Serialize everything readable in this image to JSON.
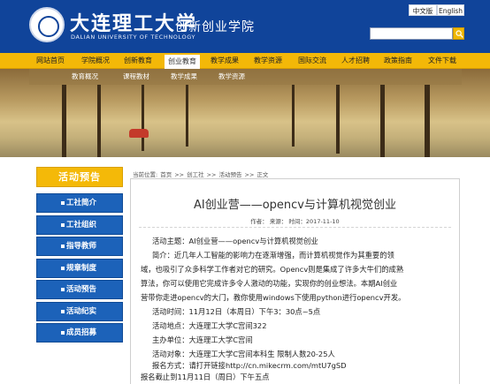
{
  "header": {
    "logo_cn": "大连理工大学",
    "logo_en": "DALIAN UNIVERSITY OF TECHNOLOGY",
    "college": "创新创业学院",
    "lang_cn": "中文版",
    "lang_en": "English",
    "search_placeholder": ""
  },
  "nav": {
    "items": [
      "网站首页",
      "学院概况",
      "创新教育",
      "创业教育",
      "教学成果",
      "教学资源",
      "国际交流",
      "人才招聘",
      "政策指南",
      "文件下载"
    ],
    "active_index": 3
  },
  "banner": {
    "sub_items": [
      "教育概况",
      "课程教材",
      "教学成果",
      "教学资源"
    ]
  },
  "sidebar": {
    "title": "活动预告",
    "items": [
      "工社简介",
      "工社组织",
      "指导教师",
      "规章制度",
      "活动预告",
      "活动纪实",
      "成员招募"
    ]
  },
  "breadcrumb": [
    "当前位置:",
    "首页",
    ">>",
    "创工社",
    ">>",
    "活动预告",
    ">>",
    "正文"
  ],
  "article": {
    "title": "AI创业营——opencv与计算机视觉创业",
    "meta": "作者：  来源：  时间：2017-11-10",
    "lines": [
      "活动主题：AI创业营——opencv与计算机视觉创业",
      "简介：近几年人工智能的影响力在逐渐增强，而计算机视觉作为其重要的领",
      "域，也吸引了众多科学工作者对它的研究。Opencv则是集成了许多大牛们的成熟",
      "算法，你可以使用它完成许多令人激动的功能，实现你的创业想法。本期AI创业",
      "营带你走进opencv的大门，教你使用windows下使用python进行opencv开发。",
      "活动时间：11月12日（本周日）下午3：30点~5点",
      "活动地点：大连理工大学C宫间322",
      "主办单位：大连理工大学C宫间",
      "活动对象：大连理工大学C宫间本科生 限制人数20-25人",
      "报名方式：请打开链接http://cn.mikecrm.com/mtU7gSD",
      "报名截止到11月11日（周日）下午五点"
    ]
  },
  "colors": {
    "header_blue": "#10449a",
    "nav_yellow": "#f3b808",
    "sidebar_blue": "#1c62b9"
  }
}
